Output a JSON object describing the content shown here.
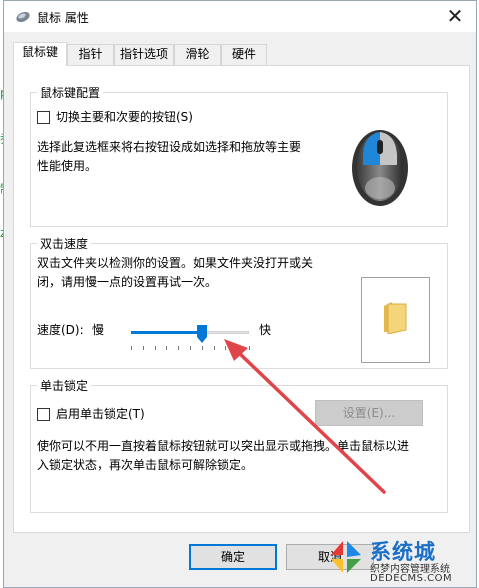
{
  "window": {
    "title": "鼠标 属性",
    "close": "✕"
  },
  "tabs": [
    {
      "label": "鼠标键",
      "active": true
    },
    {
      "label": "指针"
    },
    {
      "label": "指针选项"
    },
    {
      "label": "滑轮"
    },
    {
      "label": "硬件"
    }
  ],
  "button_config": {
    "title": "鼠标键配置",
    "switch_label": "切换主要和次要的按钮(S)",
    "switch_checked": false,
    "description": [
      "选择此复选框来将右按钮设成如选择和拖放等主要",
      "性能使用。"
    ]
  },
  "double_click": {
    "title": "双击速度",
    "description": [
      "双击文件夹以检测你的设置。如果文件夹没打开或关",
      "闭，请用慢一点的设置再试一次。"
    ],
    "speed_label": "速度(D):",
    "slow_label": "慢",
    "fast_label": "快",
    "speed_value": 0.6
  },
  "click_lock": {
    "title": "单击锁定",
    "enable_label": "启用单击锁定(T)",
    "enable_checked": false,
    "settings_label": "设置(E)...",
    "description": [
      "使你可以不用一直按着鼠标按钮就可以突出显示或拖拽。单击鼠标以进",
      "入锁定状态，再次单击鼠标可解除锁定。"
    ]
  },
  "footer": {
    "ok_label": "确定",
    "cancel_label": "取消"
  },
  "watermark": {
    "brand": "系统城",
    "site": "织梦内容管理系统",
    "domain": "DEDECMS.COM"
  },
  "colors": {
    "accent": "#0078d7",
    "arrow": "#e0454a",
    "folder": "#f5d57a"
  }
}
